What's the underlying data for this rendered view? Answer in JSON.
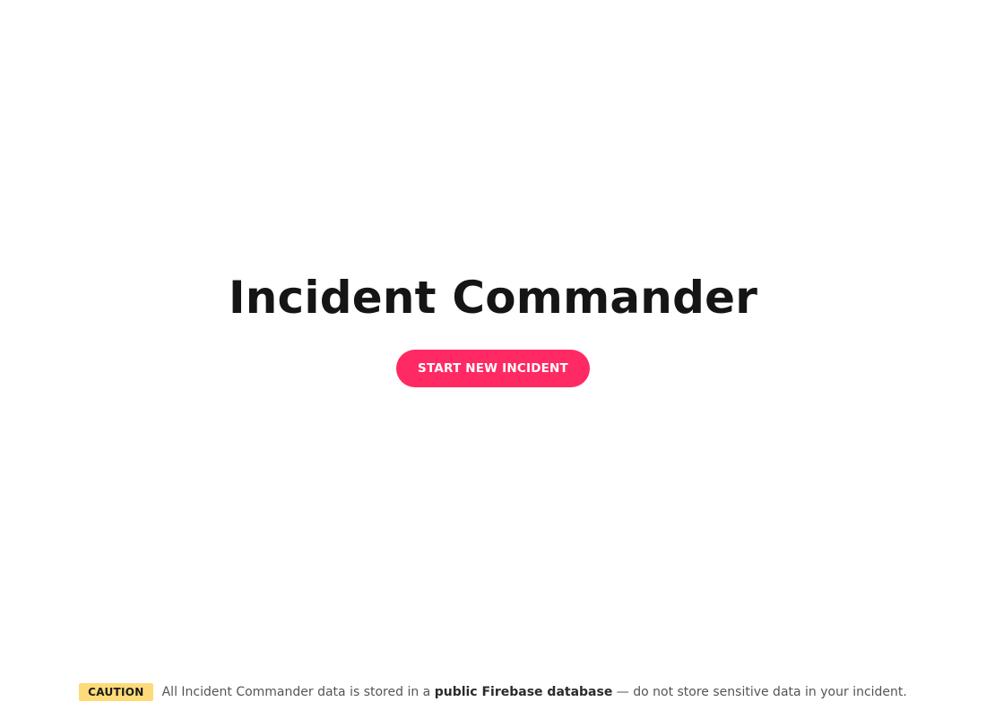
{
  "app": {
    "title": "Incident Commander",
    "start_button_label": "START NEW INCIDENT"
  },
  "footer": {
    "badge_label": "CAUTION",
    "notice_before": "All Incident Commander data is stored in a ",
    "notice_emphasis": "public Firebase database",
    "notice_after": " — do not store sensitive data in your incident."
  },
  "colors": {
    "accent": "#ff2a63",
    "caution_badge": "#fddb78",
    "title_text": "#151515",
    "notice_text": "#555555"
  }
}
